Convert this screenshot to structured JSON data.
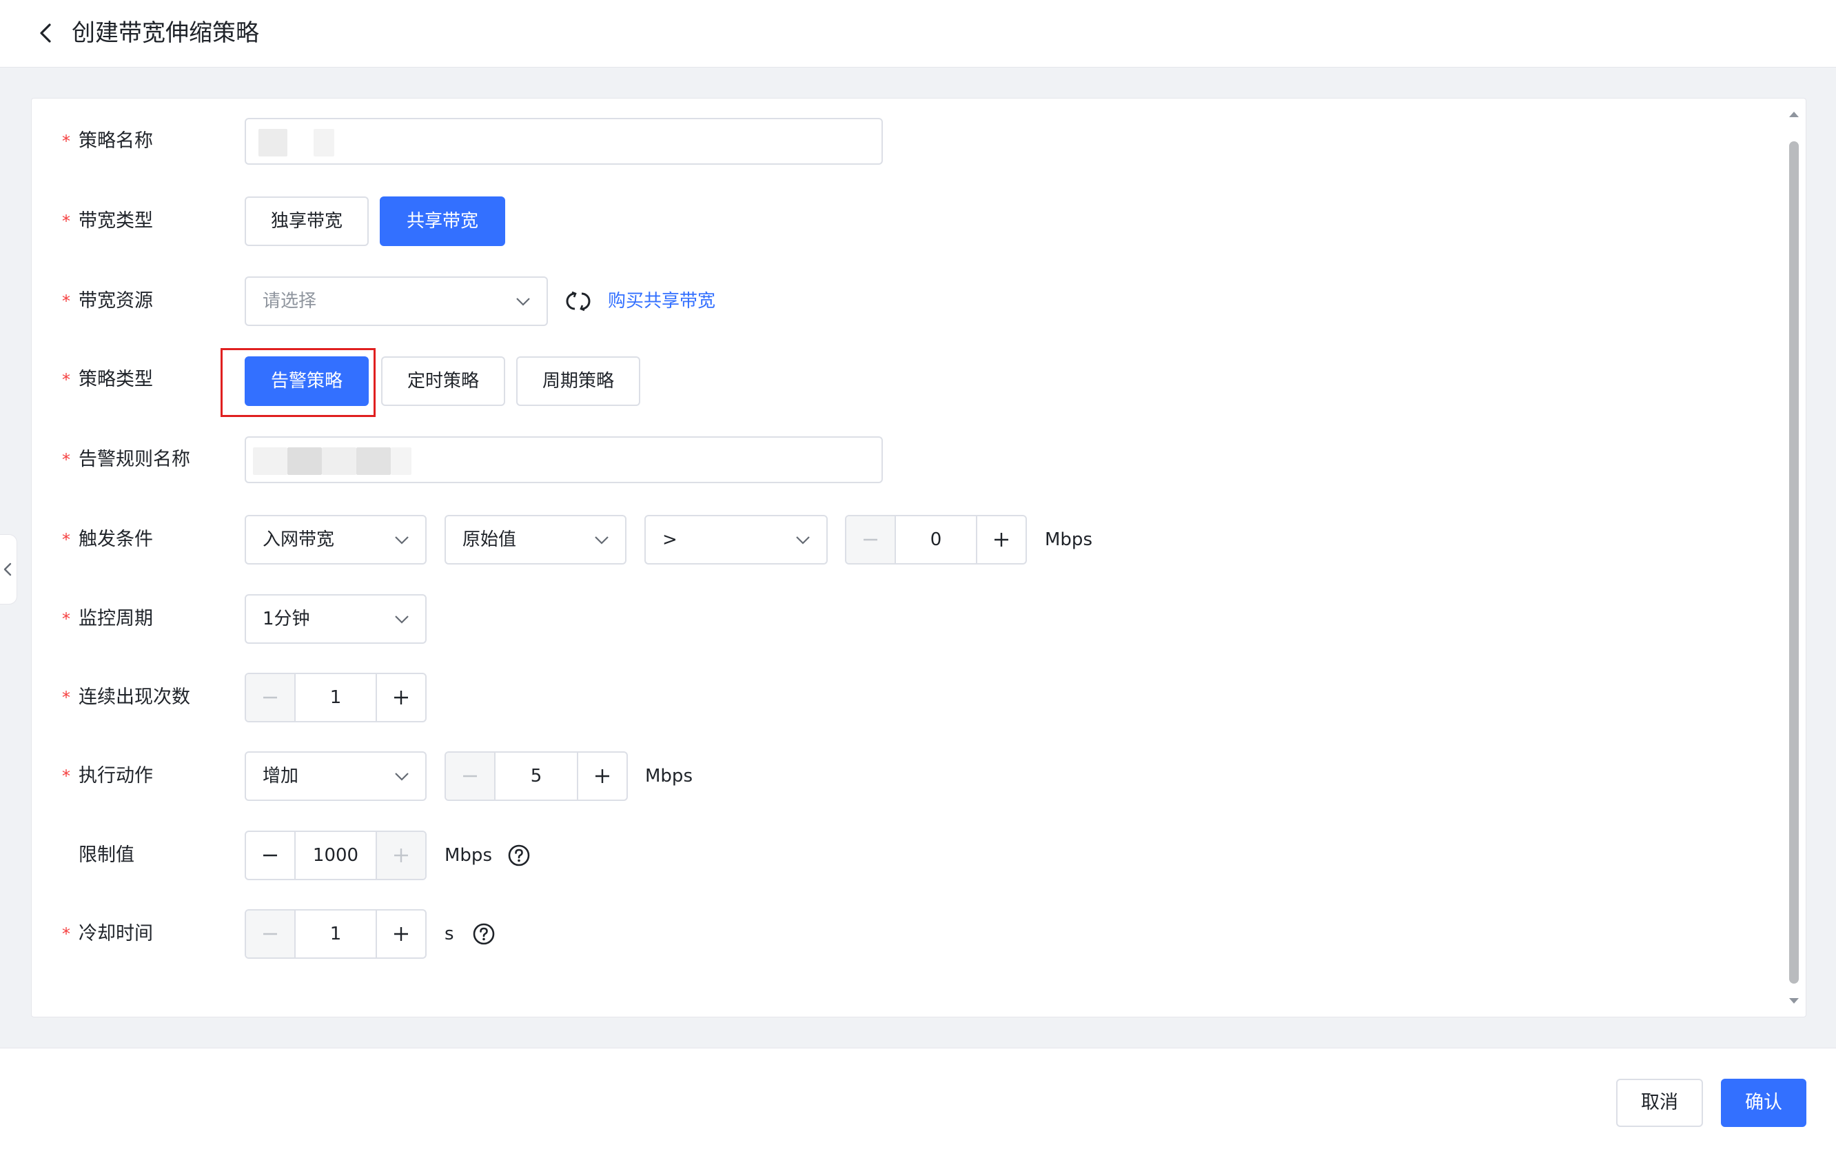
{
  "header": {
    "title": "创建带宽伸缩策略",
    "back_icon": "chevron-left-icon"
  },
  "form": {
    "policy_name": {
      "label": "策略名称",
      "value": ""
    },
    "bandwidth_type": {
      "label": "带宽类型",
      "options": [
        "独享带宽",
        "共享带宽"
      ],
      "selected": "共享带宽"
    },
    "bandwidth_resource": {
      "label": "带宽资源",
      "placeholder": "请选择",
      "buy_link": "购买共享带宽",
      "refresh_icon": "refresh-icon"
    },
    "policy_type": {
      "label": "策略类型",
      "options": [
        "告警策略",
        "定时策略",
        "周期策略"
      ],
      "selected": "告警策略"
    },
    "alarm_rule_name": {
      "label": "告警规则名称",
      "value": ""
    },
    "trigger": {
      "label": "触发条件",
      "metric": "入网带宽",
      "value_type": "原始值",
      "operator": ">",
      "threshold": "0",
      "unit": "Mbps"
    },
    "monitor_period": {
      "label": "监控周期",
      "value": "1分钟"
    },
    "consecutive": {
      "label": "连续出现次数",
      "value": "1"
    },
    "action": {
      "label": "执行动作",
      "type": "增加",
      "amount": "5",
      "unit": "Mbps"
    },
    "limit": {
      "label": "限制值",
      "value": "1000",
      "unit": "Mbps"
    },
    "cooldown": {
      "label": "冷却时间",
      "value": "1",
      "unit": "s"
    }
  },
  "footer": {
    "cancel": "取消",
    "confirm": "确认"
  },
  "colors": {
    "primary": "#3370ff",
    "required": "#f53f3f",
    "highlight": "#e02020"
  }
}
